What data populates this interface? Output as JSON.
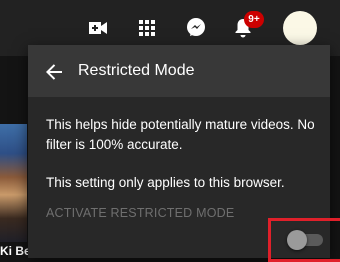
{
  "header": {
    "icons": [
      "create-video-icon",
      "apps-grid-icon",
      "messages-icon",
      "notifications-bell-icon"
    ],
    "notifications_badge": "9+"
  },
  "background": {
    "video_title": "Ki Beat (Full Song)"
  },
  "dialog": {
    "title": "Restricted Mode",
    "description": "This helps hide potentially mature videos. No filter is 100% accurate.",
    "note": "This setting only applies to this browser.",
    "toggle_label": "ACTIVATE RESTRICTED MODE",
    "toggle_on": false
  },
  "colors": {
    "highlight": "#e0202a",
    "badge": "#cc0000",
    "header_bg": "#383838",
    "dialog_bg": "#282828"
  }
}
